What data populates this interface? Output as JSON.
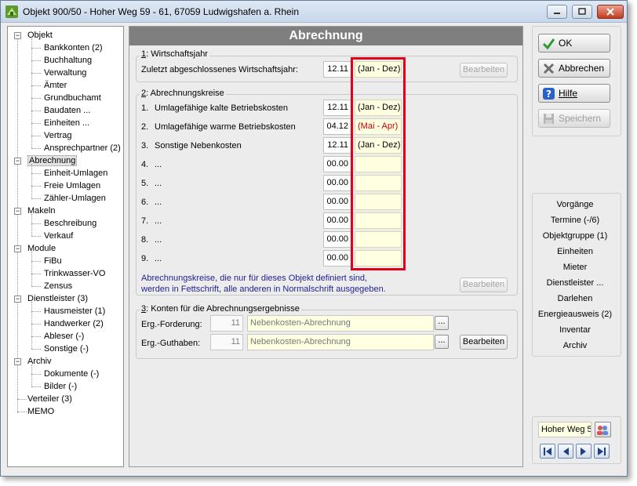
{
  "window": {
    "title": "Objekt 900/50 - Hoher Weg 59 - 61, 67059 Ludwigshafen a. Rhein",
    "app_icon_text": "HB"
  },
  "tree": [
    {
      "label": "Objekt",
      "expanded": true,
      "children": [
        "Bankkonten (2)",
        "Buchhaltung",
        "Verwaltung",
        "Ämter",
        "Grundbuchamt",
        "Baudaten ...",
        "Einheiten ...",
        "Vertrag",
        "Ansprechpartner (2)"
      ]
    },
    {
      "label": "Abrechnung",
      "expanded": true,
      "selected": true,
      "children": [
        "Einheit-Umlagen",
        "Freie Umlagen",
        "Zähler-Umlagen"
      ]
    },
    {
      "label": "Makeln",
      "expanded": true,
      "children": [
        "Beschreibung",
        "Verkauf"
      ]
    },
    {
      "label": "Module",
      "expanded": true,
      "children": [
        "FiBu",
        "Trinkwasser-VO",
        "Zensus"
      ]
    },
    {
      "label": "Dienstleister (3)",
      "expanded": true,
      "children": [
        "Hausmeister (1)",
        "Handwerker (2)",
        "Ableser (-)",
        "Sonstige (-)"
      ]
    },
    {
      "label": "Archiv",
      "expanded": true,
      "children": [
        "Dokumente (-)",
        "Bilder (-)"
      ]
    },
    {
      "label": "Verteiler (3)",
      "expanded": false,
      "children": []
    },
    {
      "label": "MEMO",
      "expanded": false,
      "children": []
    }
  ],
  "main": {
    "header": "Abrechnung",
    "wirtschaftsjahr": {
      "title_num": "1",
      "title_rest": ": Wirtschaftsjahr",
      "label": "Zuletzt abgeschlossenes Wirtschaftsjahr:",
      "value": "12.11",
      "range": "(Jan - Dez)",
      "button": "Bearbeiten"
    },
    "kreise": {
      "title_num": "2",
      "title_rest": ": Abrechnungskreise",
      "rows": [
        {
          "num": "1.",
          "label": "Umlagefähige kalte Betriebskosten",
          "value": "12.11",
          "range": "(Jan - Dez)",
          "range_color": "#000000"
        },
        {
          "num": "2.",
          "label": "Umlagefähige warme Betriebskosten",
          "value": "04.12",
          "range": "(Mai - Apr)",
          "range_color": "#c80000"
        },
        {
          "num": "3.",
          "label": "Sonstige Nebenkosten",
          "value": "12.11",
          "range": "(Jan - Dez)",
          "range_color": "#000000"
        },
        {
          "num": "4.",
          "label": "...",
          "value": "00.00",
          "range": "",
          "range_color": "#000000"
        },
        {
          "num": "5.",
          "label": "...",
          "value": "00.00",
          "range": "",
          "range_color": "#000000"
        },
        {
          "num": "6.",
          "label": "...",
          "value": "00.00",
          "range": "",
          "range_color": "#000000"
        },
        {
          "num": "7.",
          "label": "...",
          "value": "00.00",
          "range": "",
          "range_color": "#000000"
        },
        {
          "num": "8.",
          "label": "...",
          "value": "00.00",
          "range": "",
          "range_color": "#000000"
        },
        {
          "num": "9.",
          "label": "...",
          "value": "00.00",
          "range": "",
          "range_color": "#000000"
        }
      ],
      "hint_line1": "Abrechnungskreise, die nur für dieses Objekt definiert sind,",
      "hint_line2": "werden in Fettschrift, alle anderen in Normalschrift ausgegeben.",
      "button": "Bearbeiten"
    },
    "konten": {
      "title_num": "3",
      "title_rest": ": Konten für die Abrechnungsergebnisse",
      "forderung_label": "Erg.-Forderung:",
      "forderung_num": "11",
      "forderung_acct": "Nebenkosten-Abrechnung",
      "guthaben_label": "Erg.-Guthaben:",
      "guthaben_num": "11",
      "guthaben_acct": "Nebenkosten-Abrechnung",
      "dots": "...",
      "button": "Bearbeiten"
    }
  },
  "right": {
    "ok": "OK",
    "abbrechen": "Abbrechen",
    "hilfe": "Hilfe",
    "speichern": "Speichern",
    "links": [
      "Vorgänge",
      "Termine (-/6)",
      "Objektgruppe (1)",
      "Einheiten",
      "Mieter",
      "Dienstleister ...",
      "Darlehen",
      "Energieausweis (2)",
      "Inventar",
      "Archiv"
    ],
    "object_name": "Hoher Weg 5"
  },
  "colors": {
    "highlight_box": "#e3001b",
    "header_bg": "#7f7f7f",
    "hint_text": "#1f1f8f"
  }
}
